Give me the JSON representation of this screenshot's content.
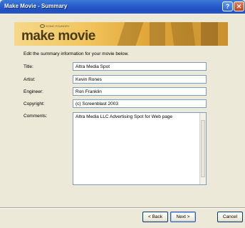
{
  "window": {
    "title": "Make Movie - Summary"
  },
  "banner": {
    "logo_text": "make movie",
    "brand_text": "SONIC FOUNDRY"
  },
  "instruction": "Edit the summary information for your movie below.",
  "fields": {
    "title": {
      "label": "Title:",
      "value": "Altra Media Spot"
    },
    "artist": {
      "label": "Artist:",
      "value": "Kevin Rones"
    },
    "engineer": {
      "label": "Engineer:",
      "value": "Ron Franklin"
    },
    "copyright": {
      "label": "Copyright:",
      "value": "(c) Screenblast 2003"
    },
    "comments": {
      "label": "Comments:",
      "value": "Altra Media LLC Advertising Spot for Web page"
    }
  },
  "buttons": {
    "back": "< Back",
    "next": "Next >",
    "cancel": "Cancel"
  },
  "icons": {
    "help": "help-icon",
    "close": "close-icon"
  },
  "colors": {
    "titlebar": "#2a5fce",
    "dialog_bg": "#ece9d8",
    "banner": "#f1c45c"
  }
}
